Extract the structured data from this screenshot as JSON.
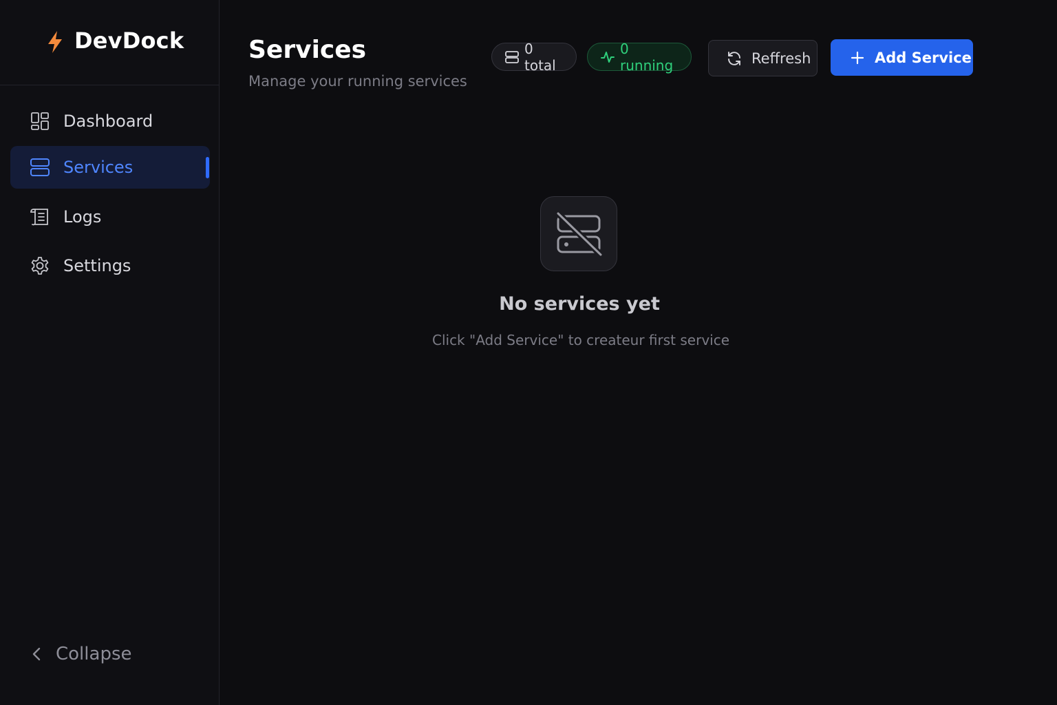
{
  "app": {
    "name": "DevDock",
    "logo_icon": "lightning-bolt-icon",
    "accent_color": "#2563eb",
    "logo_color": "#f48a3c"
  },
  "sidebar": {
    "items": [
      {
        "label": "Dashboard",
        "icon": "dashboard-icon",
        "active": false
      },
      {
        "label": "Services",
        "icon": "server-icon",
        "active": true
      },
      {
        "label": "Logs",
        "icon": "scroll-icon",
        "active": false
      },
      {
        "label": "Settings",
        "icon": "gear-icon",
        "active": false
      }
    ],
    "collapse_label": "Collapse"
  },
  "header": {
    "title": "Services",
    "subtitle": "Manage your running services",
    "total_label": "0 total",
    "running_label": "0 running",
    "refresh_label": "Reffresh",
    "add_label": "Add Service"
  },
  "empty_state": {
    "icon": "server-off-icon",
    "title": "No services yet",
    "description": "Click \"Add Service\" to createur first service"
  }
}
